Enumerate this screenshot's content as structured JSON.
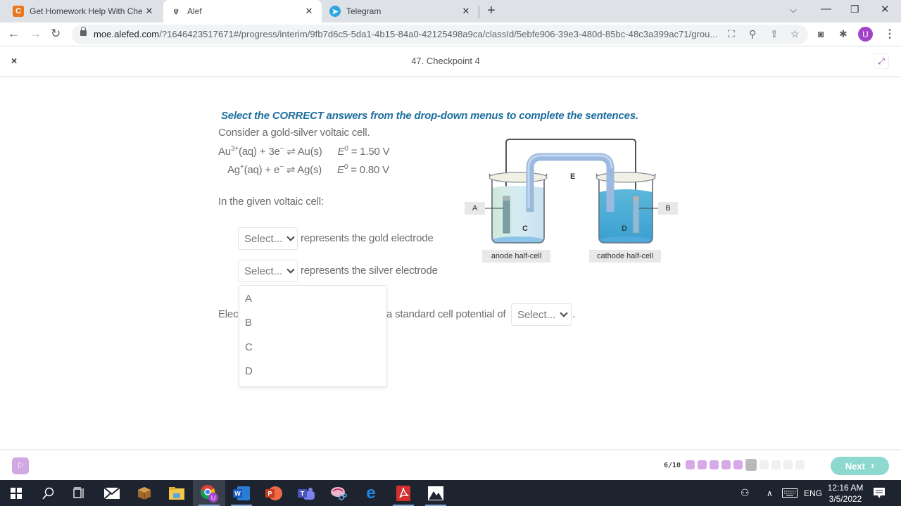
{
  "browser": {
    "tabs": [
      {
        "title": "Get Homework Help With Chegg",
        "icon": "chegg-icon",
        "active": false
      },
      {
        "title": "Alef",
        "icon": "alef-icon",
        "active": true
      },
      {
        "title": "Telegram",
        "icon": "telegram-icon",
        "active": false
      }
    ],
    "new_tab_symbol": "+",
    "url_host": "moe.alefed.com",
    "url_path": "/?1646423517671#/progress/interim/9fb7d6c5-5da1-4b15-84a0-42125498a9ca/classId/5ebfe906-39e3-480d-85bc-48c3a399ac71/grou...",
    "profile_initial": "U"
  },
  "app": {
    "title": "47. Checkpoint 4",
    "close_symbol": "×"
  },
  "question": {
    "instruction": "Select the CORRECT answers from the drop-down menus to complete the sentences.",
    "intro": "Consider a gold-silver voltaic cell.",
    "reactions": [
      {
        "species": "Au",
        "charge": "3+",
        "rest": "(aq) + 3e",
        "electron_sign": "−",
        "product": " ⇌ Au(s)",
        "e_label": "E",
        "e_sup": "0",
        "e_value": " = 1.50 V"
      },
      {
        "species": "Ag",
        "charge": "+",
        "rest": "(aq) + e",
        "electron_sign": "−",
        "product": " ⇌ Ag(s)",
        "e_label": "E",
        "e_sup": "0",
        "e_value": " = 0.80 V"
      }
    ],
    "lead_in": "In the given voltaic cell:",
    "sentences": [
      {
        "select_value": "Select...",
        "text": "represents the gold electrode"
      },
      {
        "select_value": "Select...",
        "text": "represents the silver electrode"
      }
    ],
    "third_sentence_prefix": "Elec",
    "third_sentence_suffix": "a standard cell potential of",
    "third_select_value": "Select...",
    "third_sentence_end": ".",
    "open_dropdown_options": [
      "A",
      "B",
      "C",
      "D"
    ]
  },
  "diagram": {
    "labels": {
      "A": "A",
      "B": "B",
      "C": "C",
      "D": "D",
      "E": "E"
    },
    "anode_caption": "anode half-cell",
    "cathode_caption": "cathode half-cell"
  },
  "footer": {
    "progress_text": "6/10",
    "progress_current": 6,
    "progress_total": 10,
    "next_label": "Next",
    "next_arrow": "›"
  },
  "taskbar": {
    "apps": [
      "start",
      "search",
      "task-view",
      "mail",
      "minecraft",
      "file-explorer",
      "chrome",
      "word",
      "powerpoint",
      "teams",
      "snip",
      "edge",
      "acrobat",
      "photos"
    ],
    "language": "ENG",
    "time": "12:16 AM",
    "date": "3/5/2022"
  }
}
